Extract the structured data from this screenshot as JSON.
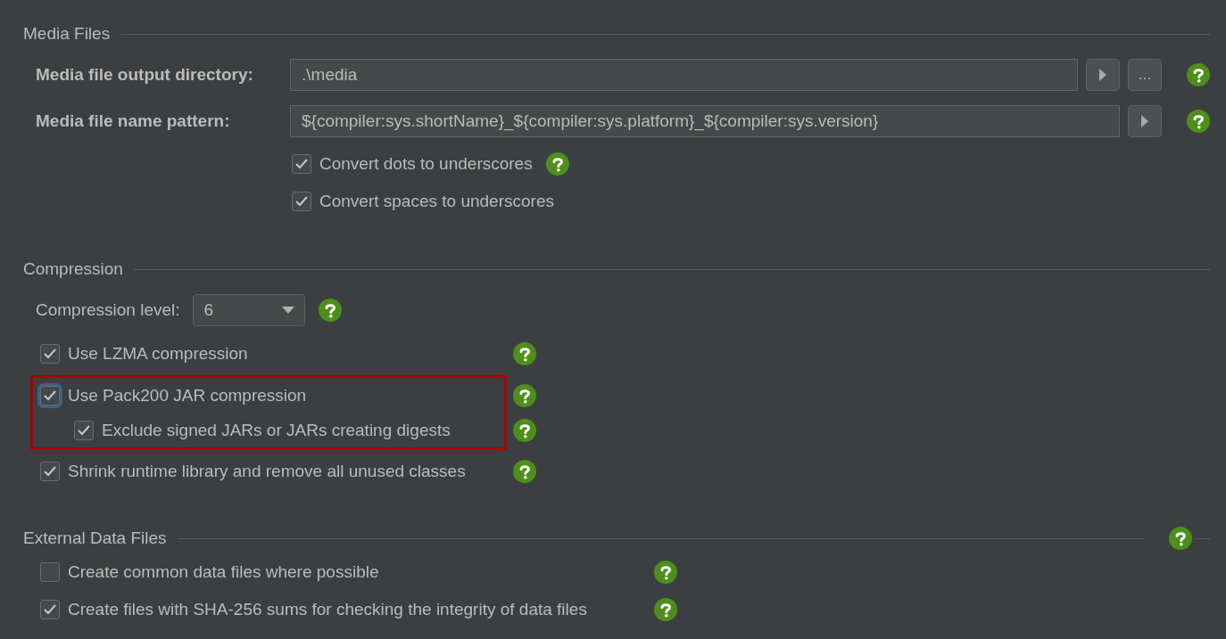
{
  "media_files": {
    "title": "Media Files",
    "fields": [
      {
        "label": "Media file output directory:",
        "value": ".\\media",
        "browse_label": "…"
      },
      {
        "label": "Media file name pattern:",
        "value": "${compiler:sys.shortName}_${compiler:sys.platform}_${compiler:sys.version}"
      }
    ],
    "options": [
      {
        "label": "Convert dots to underscores",
        "checked": true,
        "help": true
      },
      {
        "label": "Convert spaces to underscores",
        "checked": true,
        "help": false
      }
    ]
  },
  "compression": {
    "title": "Compression",
    "level_label": "Compression level:",
    "level_value": "6",
    "options": [
      {
        "label": "Use LZMA compression",
        "checked": true
      },
      {
        "label": "Use Pack200 JAR compression",
        "checked": true,
        "focused": true,
        "highlighted": true,
        "children": [
          {
            "label": "Exclude signed JARs or JARs creating digests",
            "checked": true
          }
        ]
      },
      {
        "label": "Shrink runtime library and remove all unused classes",
        "checked": true
      }
    ]
  },
  "external_data_files": {
    "title": "External Data Files",
    "help": true,
    "options": [
      {
        "label": "Create common data files where possible",
        "checked": false
      },
      {
        "label": "Create files with SHA-256 sums for checking the integrity of data files",
        "checked": true
      }
    ]
  }
}
